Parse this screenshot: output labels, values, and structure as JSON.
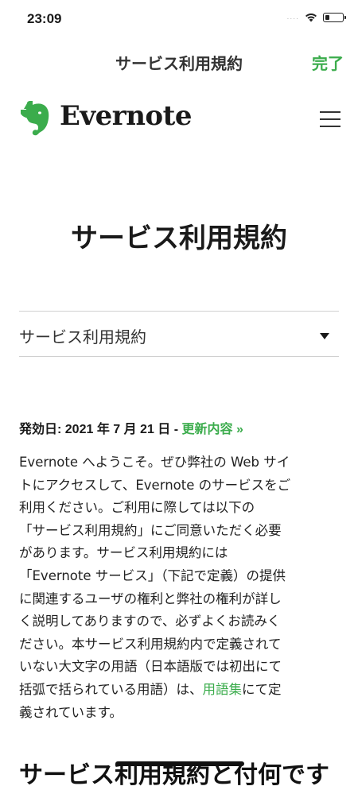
{
  "status_bar": {
    "time": "23:09",
    "signal": "....",
    "battery_level": 0.25
  },
  "nav": {
    "title": "サービス利用規約",
    "done_label": "完了"
  },
  "brand": {
    "name": "Evernote",
    "icon": "evernote-elephant-icon",
    "color": "#3bac4c"
  },
  "menu": {
    "icon": "hamburger-menu-icon"
  },
  "page": {
    "heading": "サービス利用規約",
    "dropdown_selected": "サービス利用規約",
    "effective_date": "発効日: 2021 年 7 月 21 日 - ",
    "changes_link": "更新内容 »",
    "body_lines": [
      "Evernote へようこそ。ぜひ弊社の Web サイ",
      "トにアクセスして、Evernote のサービスをご",
      "利用ください。ご利用に際しては以下の",
      "「サービス利用規約」にご同意いただく必要",
      "があります。サービス利用規約には",
      "「Evernote サービス」（下記で定義）の提供",
      "に関連するユーザの権利と弊社の権利が詳し",
      "く説明してありますので、必ずよくお読みく",
      "ださい。本サービス利用規約内で定義されて",
      "いない大文字の用語（日本語版では初出にて"
    ],
    "body_last_prefix": "括弧で括られている用語）は、",
    "glossary_link": "用語集",
    "body_last_suffix": "にて定",
    "body_final_line": "義されています。",
    "section_heading": "サービス利用規約と付何です"
  }
}
